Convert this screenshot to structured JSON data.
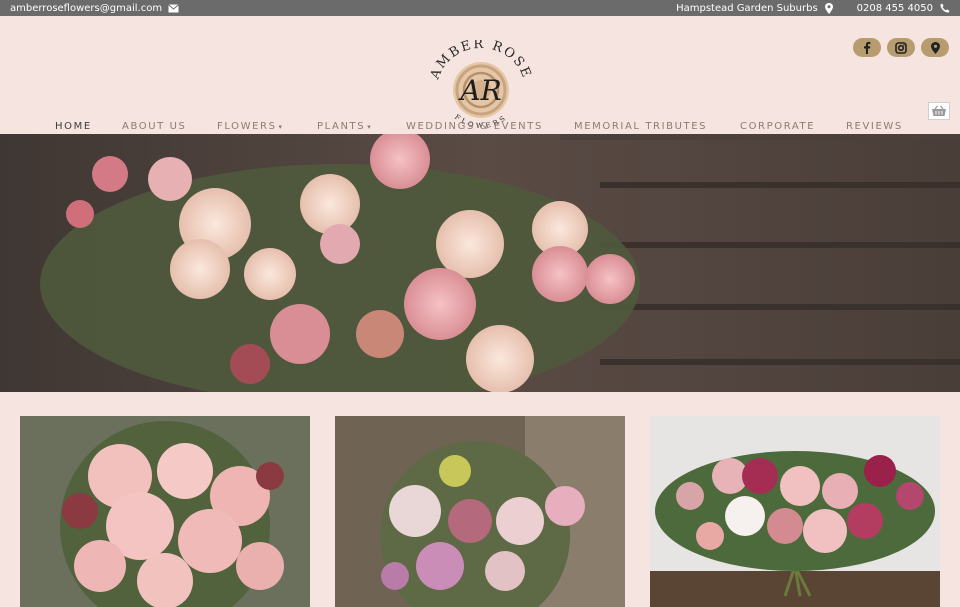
{
  "topbar": {
    "email": "amberroseflowers@gmail.com",
    "location": "Hampstead Garden Suburbs",
    "phone": "0208 455 4050"
  },
  "logo": {
    "arc_top": "AMBER ROSE",
    "arc_bottom": "FLOWERS",
    "monogram": "AR"
  },
  "nav": {
    "items": [
      {
        "label": "HOME",
        "active": true
      },
      {
        "label": "ABOUT US"
      },
      {
        "label": "FLOWERS",
        "dropdown": true
      },
      {
        "label": "PLANTS",
        "dropdown": true
      },
      {
        "label": "WEDDINGS & EVENTS"
      },
      {
        "label": "MEMORIAL TRIBUTES"
      },
      {
        "label": "CORPORATE"
      },
      {
        "label": "REVIEWS"
      }
    ]
  },
  "colors": {
    "background": "#f5e4df",
    "topbar": "#6b6b6b",
    "social_button": "#b79c6f",
    "nav_text": "#8a7d72"
  },
  "icons": [
    "envelope-icon",
    "map-pin-icon",
    "phone-icon",
    "facebook-icon",
    "instagram-icon",
    "location-icon",
    "shopping-basket-icon"
  ]
}
